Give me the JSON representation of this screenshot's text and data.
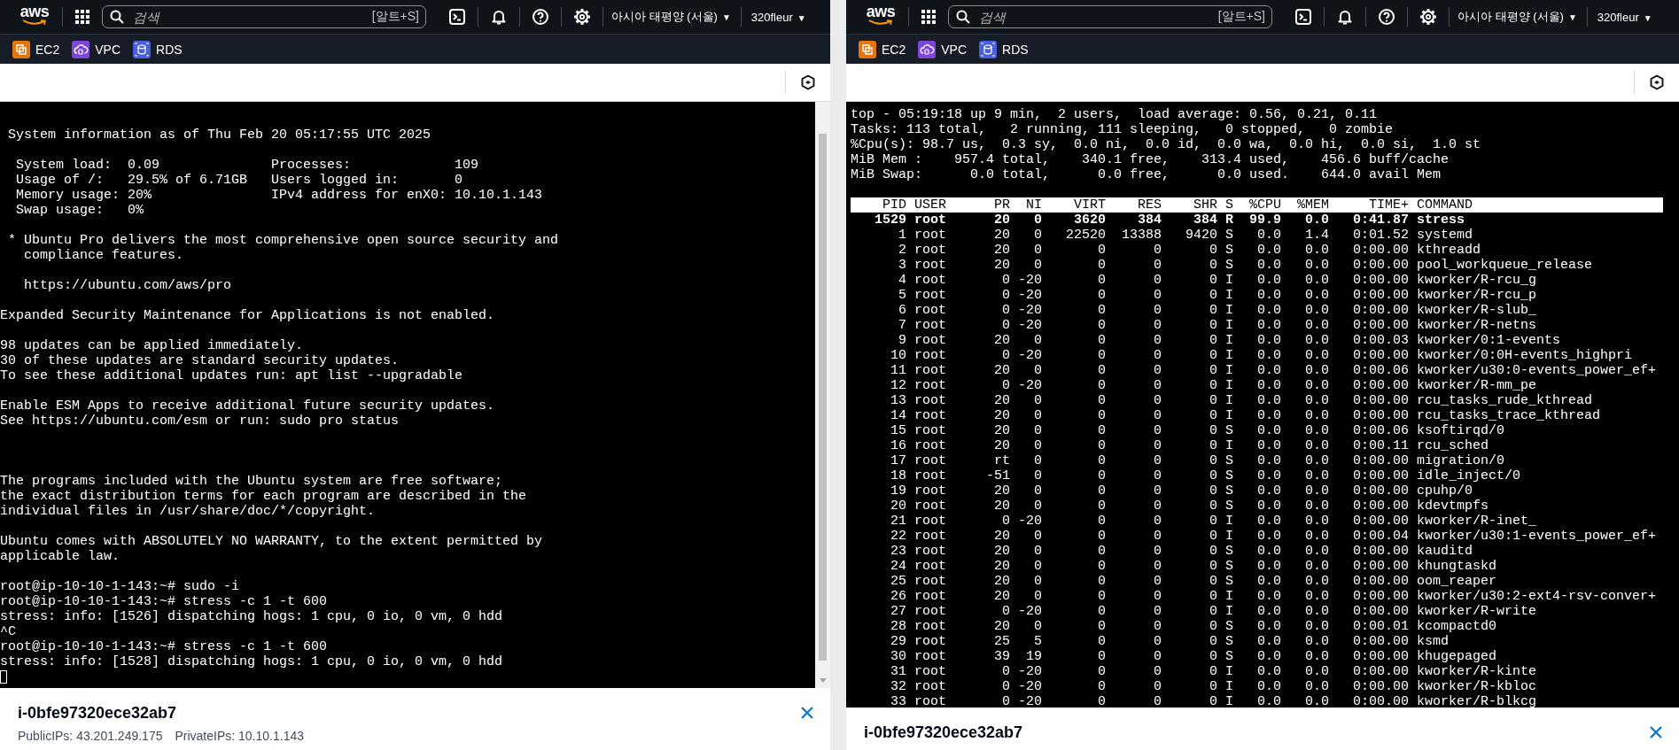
{
  "panes": [
    {
      "nav": {
        "logo": "aws",
        "search": {
          "placeholder": "검색",
          "shortcut": "[알트+S]"
        },
        "region": "아시아 태평양 (서울)",
        "region_caret": "▼",
        "account": "320fleur",
        "account_caret": "▼"
      },
      "favorites": [
        {
          "label": "EC2",
          "kind": "stack",
          "color": "#e5760f"
        },
        {
          "label": "VPC",
          "kind": "cloud",
          "color": "#7f45d8"
        },
        {
          "label": "RDS",
          "kind": "database",
          "color": "#4a5fe0"
        }
      ],
      "terminal": {
        "kind": "shell",
        "lines": [
          {
            "kind": "text",
            "text": " System information as of Thu Feb 20 05:17:55 UTC 2025"
          },
          {
            "kind": "blank"
          },
          {
            "kind": "text",
            "text": "  System load:  0.09              Processes:             109"
          },
          {
            "kind": "text",
            "text": "  Usage of /:   29.5% of 6.71GB   Users logged in:       0"
          },
          {
            "kind": "text",
            "text": "  Memory usage: 20%               IPv4 address for enX0: 10.10.1.143"
          },
          {
            "kind": "text",
            "text": "  Swap usage:   0%"
          },
          {
            "kind": "blank"
          },
          {
            "kind": "text",
            "text": " * Ubuntu Pro delivers the most comprehensive open source security and"
          },
          {
            "kind": "text",
            "text": "   compliance features."
          },
          {
            "kind": "blank"
          },
          {
            "kind": "text",
            "text": "   https://ubuntu.com/aws/pro"
          },
          {
            "kind": "blank"
          },
          {
            "kind": "text",
            "text": "Expanded Security Maintenance for Applications is not enabled."
          },
          {
            "kind": "blank"
          },
          {
            "kind": "text",
            "text": "98 updates can be applied immediately."
          },
          {
            "kind": "text",
            "text": "30 of these updates are standard security updates."
          },
          {
            "kind": "text",
            "text": "To see these additional updates run: apt list --upgradable"
          },
          {
            "kind": "blank"
          },
          {
            "kind": "text",
            "text": "Enable ESM Apps to receive additional future security updates."
          },
          {
            "kind": "text",
            "text": "See https://ubuntu.com/esm or run: sudo pro status"
          },
          {
            "kind": "blank"
          },
          {
            "kind": "blank"
          },
          {
            "kind": "blank"
          },
          {
            "kind": "text",
            "text": "The programs included with the Ubuntu system are free software;"
          },
          {
            "kind": "text",
            "text": "the exact distribution terms for each program are described in the"
          },
          {
            "kind": "text",
            "text": "individual files in /usr/share/doc/*/copyright."
          },
          {
            "kind": "blank"
          },
          {
            "kind": "text",
            "text": "Ubuntu comes with ABSOLUTELY NO WARRANTY, to the extent permitted by"
          },
          {
            "kind": "text",
            "text": "applicable law."
          },
          {
            "kind": "blank"
          },
          {
            "kind": "text",
            "text": "root@ip-10-10-1-143:~# sudo -i"
          },
          {
            "kind": "text",
            "text": "root@ip-10-10-1-143:~# stress -c 1 -t 600"
          },
          {
            "kind": "text",
            "text": "stress: info: [1526] dispatching hogs: 1 cpu, 0 io, 0 vm, 0 hdd"
          },
          {
            "kind": "text",
            "text": "^C"
          },
          {
            "kind": "text",
            "text": "root@ip-10-10-1-143:~# stress -c 1 -t 600"
          },
          {
            "kind": "text",
            "text": "stress: info: [1528] dispatching hogs: 1 cpu, 0 io, 0 vm, 0 hdd"
          },
          {
            "kind": "cursor"
          }
        ]
      },
      "instance": {
        "id": "i-0bfe97320ece32ab7",
        "details": [
          "PublicIPs: 43.201.249.175",
          "PrivateIPs: 10.10.1.143"
        ]
      }
    },
    {
      "nav": {
        "logo": "aws",
        "search": {
          "placeholder": "검색",
          "shortcut": "[알트+S]"
        },
        "region": "아시아 태평양 (서울)",
        "region_caret": "▼",
        "account": "320fleur",
        "account_caret": "▼"
      },
      "favorites": [
        {
          "label": "EC2",
          "kind": "stack",
          "color": "#e5760f"
        },
        {
          "label": "VPC",
          "kind": "cloud",
          "color": "#7f45d8"
        },
        {
          "label": "RDS",
          "kind": "database",
          "color": "#4a5fe0"
        }
      ],
      "terminal": {
        "kind": "top",
        "summary": [
          "top - 05:19:18 up 9 min,  2 users,  load average: 0.56, 0.21, 0.11",
          "Tasks: 113 total,   2 running, 111 sleeping,   0 stopped,   0 zombie",
          "%Cpu(s): 98.7 us,  0.3 sy,  0.0 ni,  0.0 id,  0.0 wa,  0.0 hi,  0.0 si,  1.0 st",
          "MiB Mem :    957.4 total,    340.1 free,    313.4 used,    456.6 buff/cache",
          "MiB Swap:      0.0 total,      0.0 free,      0.0 used.    644.0 avail Mem"
        ],
        "columns": [
          "PID",
          "USER",
          "PR",
          "NI",
          "VIRT",
          "RES",
          "SHR",
          "S",
          "%CPU",
          "%MEM",
          "TIME+",
          "COMMAND"
        ],
        "rows": [
          {
            "highlighted": true,
            "cells": [
              "1529",
              "root",
              "20",
              "0",
              "3620",
              "384",
              "384",
              "R",
              "99.9",
              "0.0",
              "0:41.87",
              "stress"
            ]
          },
          {
            "highlighted": false,
            "cells": [
              "1",
              "root",
              "20",
              "0",
              "22520",
              "13388",
              "9420",
              "S",
              "0.0",
              "1.4",
              "0:01.52",
              "systemd"
            ]
          },
          {
            "highlighted": false,
            "cells": [
              "2",
              "root",
              "20",
              "0",
              "0",
              "0",
              "0",
              "S",
              "0.0",
              "0.0",
              "0:00.00",
              "kthreadd"
            ]
          },
          {
            "highlighted": false,
            "cells": [
              "3",
              "root",
              "20",
              "0",
              "0",
              "0",
              "0",
              "S",
              "0.0",
              "0.0",
              "0:00.00",
              "pool_workqueue_release"
            ]
          },
          {
            "highlighted": false,
            "cells": [
              "4",
              "root",
              "0",
              "-20",
              "0",
              "0",
              "0",
              "I",
              "0.0",
              "0.0",
              "0:00.00",
              "kworker/R-rcu_g"
            ]
          },
          {
            "highlighted": false,
            "cells": [
              "5",
              "root",
              "0",
              "-20",
              "0",
              "0",
              "0",
              "I",
              "0.0",
              "0.0",
              "0:00.00",
              "kworker/R-rcu_p"
            ]
          },
          {
            "highlighted": false,
            "cells": [
              "6",
              "root",
              "0",
              "-20",
              "0",
              "0",
              "0",
              "I",
              "0.0",
              "0.0",
              "0:00.00",
              "kworker/R-slub_"
            ]
          },
          {
            "highlighted": false,
            "cells": [
              "7",
              "root",
              "0",
              "-20",
              "0",
              "0",
              "0",
              "I",
              "0.0",
              "0.0",
              "0:00.00",
              "kworker/R-netns"
            ]
          },
          {
            "highlighted": false,
            "cells": [
              "9",
              "root",
              "20",
              "0",
              "0",
              "0",
              "0",
              "I",
              "0.0",
              "0.0",
              "0:00.03",
              "kworker/0:1-events"
            ]
          },
          {
            "highlighted": false,
            "cells": [
              "10",
              "root",
              "0",
              "-20",
              "0",
              "0",
              "0",
              "I",
              "0.0",
              "0.0",
              "0:00.00",
              "kworker/0:0H-events_highpri"
            ]
          },
          {
            "highlighted": false,
            "cells": [
              "11",
              "root",
              "20",
              "0",
              "0",
              "0",
              "0",
              "I",
              "0.0",
              "0.0",
              "0:00.06",
              "kworker/u30:0-events_power_ef+"
            ]
          },
          {
            "highlighted": false,
            "cells": [
              "12",
              "root",
              "0",
              "-20",
              "0",
              "0",
              "0",
              "I",
              "0.0",
              "0.0",
              "0:00.00",
              "kworker/R-mm_pe"
            ]
          },
          {
            "highlighted": false,
            "cells": [
              "13",
              "root",
              "20",
              "0",
              "0",
              "0",
              "0",
              "I",
              "0.0",
              "0.0",
              "0:00.00",
              "rcu_tasks_rude_kthread"
            ]
          },
          {
            "highlighted": false,
            "cells": [
              "14",
              "root",
              "20",
              "0",
              "0",
              "0",
              "0",
              "I",
              "0.0",
              "0.0",
              "0:00.00",
              "rcu_tasks_trace_kthread"
            ]
          },
          {
            "highlighted": false,
            "cells": [
              "15",
              "root",
              "20",
              "0",
              "0",
              "0",
              "0",
              "S",
              "0.0",
              "0.0",
              "0:00.06",
              "ksoftirqd/0"
            ]
          },
          {
            "highlighted": false,
            "cells": [
              "16",
              "root",
              "20",
              "0",
              "0",
              "0",
              "0",
              "I",
              "0.0",
              "0.0",
              "0:00.11",
              "rcu_sched"
            ]
          },
          {
            "highlighted": false,
            "cells": [
              "17",
              "root",
              "rt",
              "0",
              "0",
              "0",
              "0",
              "S",
              "0.0",
              "0.0",
              "0:00.00",
              "migration/0"
            ]
          },
          {
            "highlighted": false,
            "cells": [
              "18",
              "root",
              "-51",
              "0",
              "0",
              "0",
              "0",
              "S",
              "0.0",
              "0.0",
              "0:00.00",
              "idle_inject/0"
            ]
          },
          {
            "highlighted": false,
            "cells": [
              "19",
              "root",
              "20",
              "0",
              "0",
              "0",
              "0",
              "S",
              "0.0",
              "0.0",
              "0:00.00",
              "cpuhp/0"
            ]
          },
          {
            "highlighted": false,
            "cells": [
              "20",
              "root",
              "20",
              "0",
              "0",
              "0",
              "0",
              "S",
              "0.0",
              "0.0",
              "0:00.00",
              "kdevtmpfs"
            ]
          },
          {
            "highlighted": false,
            "cells": [
              "21",
              "root",
              "0",
              "-20",
              "0",
              "0",
              "0",
              "I",
              "0.0",
              "0.0",
              "0:00.00",
              "kworker/R-inet_"
            ]
          },
          {
            "highlighted": false,
            "cells": [
              "22",
              "root",
              "20",
              "0",
              "0",
              "0",
              "0",
              "I",
              "0.0",
              "0.0",
              "0:00.04",
              "kworker/u30:1-events_power_ef+"
            ]
          },
          {
            "highlighted": false,
            "cells": [
              "23",
              "root",
              "20",
              "0",
              "0",
              "0",
              "0",
              "S",
              "0.0",
              "0.0",
              "0:00.00",
              "kauditd"
            ]
          },
          {
            "highlighted": false,
            "cells": [
              "24",
              "root",
              "20",
              "0",
              "0",
              "0",
              "0",
              "S",
              "0.0",
              "0.0",
              "0:00.00",
              "khungtaskd"
            ]
          },
          {
            "highlighted": false,
            "cells": [
              "25",
              "root",
              "20",
              "0",
              "0",
              "0",
              "0",
              "S",
              "0.0",
              "0.0",
              "0:00.00",
              "oom_reaper"
            ]
          },
          {
            "highlighted": false,
            "cells": [
              "26",
              "root",
              "20",
              "0",
              "0",
              "0",
              "0",
              "I",
              "0.0",
              "0.0",
              "0:00.00",
              "kworker/u30:2-ext4-rsv-conver+"
            ]
          },
          {
            "highlighted": false,
            "cells": [
              "27",
              "root",
              "0",
              "-20",
              "0",
              "0",
              "0",
              "I",
              "0.0",
              "0.0",
              "0:00.00",
              "kworker/R-write"
            ]
          },
          {
            "highlighted": false,
            "cells": [
              "28",
              "root",
              "20",
              "0",
              "0",
              "0",
              "0",
              "S",
              "0.0",
              "0.0",
              "0:00.01",
              "kcompactd0"
            ]
          },
          {
            "highlighted": false,
            "cells": [
              "29",
              "root",
              "25",
              "5",
              "0",
              "0",
              "0",
              "S",
              "0.0",
              "0.0",
              "0:00.00",
              "ksmd"
            ]
          },
          {
            "highlighted": false,
            "cells": [
              "30",
              "root",
              "39",
              "19",
              "0",
              "0",
              "0",
              "S",
              "0.0",
              "0.0",
              "0:00.00",
              "khugepaged"
            ]
          },
          {
            "highlighted": false,
            "cells": [
              "31",
              "root",
              "0",
              "-20",
              "0",
              "0",
              "0",
              "I",
              "0.0",
              "0.0",
              "0:00.00",
              "kworker/R-kinte"
            ]
          },
          {
            "highlighted": false,
            "cells": [
              "32",
              "root",
              "0",
              "-20",
              "0",
              "0",
              "0",
              "I",
              "0.0",
              "0.0",
              "0:00.00",
              "kworker/R-kbloc"
            ]
          },
          {
            "highlighted": false,
            "cells": [
              "33",
              "root",
              "0",
              "-20",
              "0",
              "0",
              "0",
              "I",
              "0.0",
              "0.0",
              "0:00.00",
              "kworker/R-blkcg"
            ]
          }
        ]
      },
      "instance": {
        "id": "i-0bfe97320ece32ab7"
      }
    }
  ]
}
